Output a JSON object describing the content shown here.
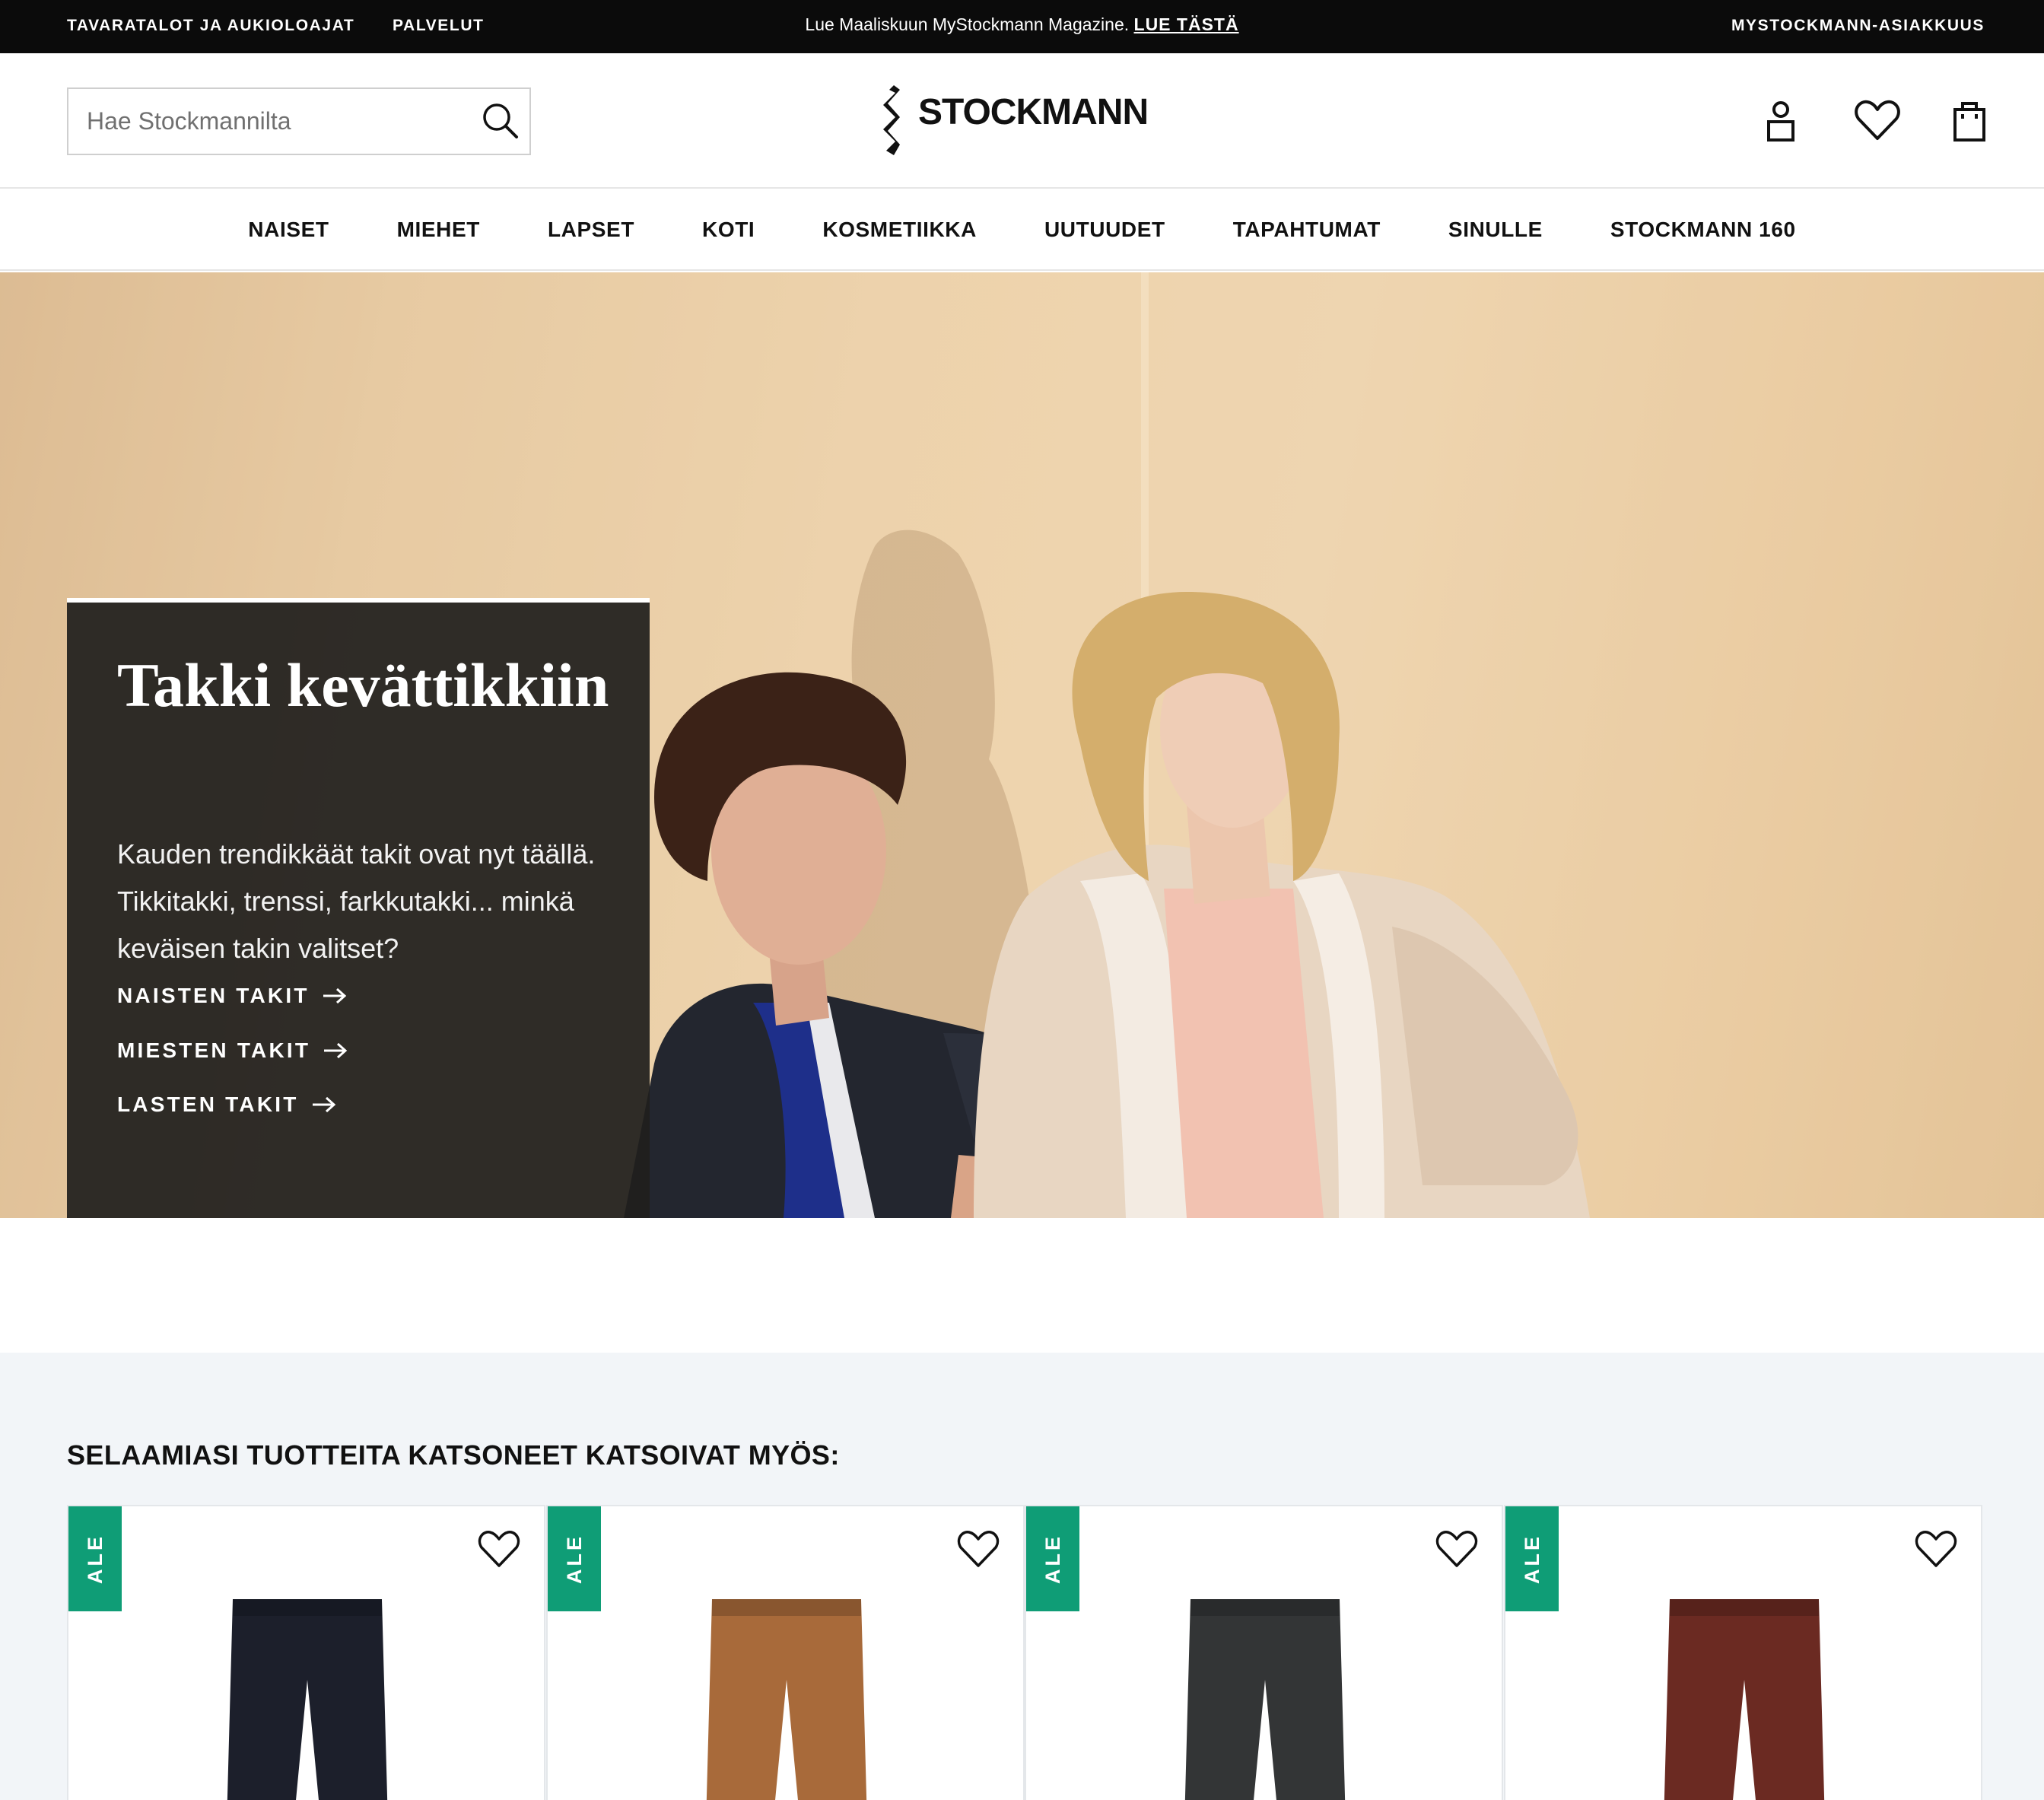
{
  "topbar": {
    "stores_hours": "TAVARATALOT JA AUKIOLOAJAT",
    "services": "PALVELUT",
    "announcement": "Lue Maaliskuun MyStockmann Magazine.",
    "announcement_link": "LUE TÄSTÄ",
    "membership": "MYSTOCKMANN-ASIAKKUUS"
  },
  "header": {
    "search_placeholder": "Hae Stockmannilta",
    "search_value": "",
    "logo_text": "STOCKMANN",
    "icons": [
      "search-icon",
      "account-icon",
      "heart-icon",
      "shopping-bag-icon"
    ]
  },
  "nav": {
    "items": [
      {
        "label": "NAISET"
      },
      {
        "label": "MIEHET"
      },
      {
        "label": "LAPSET"
      },
      {
        "label": "KOTI"
      },
      {
        "label": "KOSMETIIKKA"
      },
      {
        "label": "UUTUUDET"
      },
      {
        "label": "TAPAHTUMAT"
      },
      {
        "label": "SINULLE"
      },
      {
        "label": "STOCKMANN 160"
      }
    ]
  },
  "hero": {
    "title": "Takki kevättikkiin",
    "text": "Kauden trendikkäät takit ovat nyt täällä. Tikkitakki, trenssi, farkkutakki... minkä keväisen takin valitset?",
    "links": [
      {
        "label": "NAISTEN TAKIT"
      },
      {
        "label": "MIESTEN TAKIT"
      },
      {
        "label": "LASTEN TAKIT"
      }
    ]
  },
  "recommendations": {
    "title": "SELAAMIASI TUOTTEITA KATSONEET KATSOIVAT MYÖS:",
    "products": [
      {
        "badge": "ALE",
        "color": "#1c1f2b"
      },
      {
        "badge": "ALE",
        "color": "#a86a3a"
      },
      {
        "badge": "ALE",
        "color": "#333536"
      },
      {
        "badge": "ALE",
        "color": "#6b2a22"
      }
    ]
  },
  "colors": {
    "topbar": "#0b0b0b",
    "sale_badge": "#0f9d76",
    "promo_panel": "#201f1d",
    "recs_background": "#f2f5f8"
  }
}
